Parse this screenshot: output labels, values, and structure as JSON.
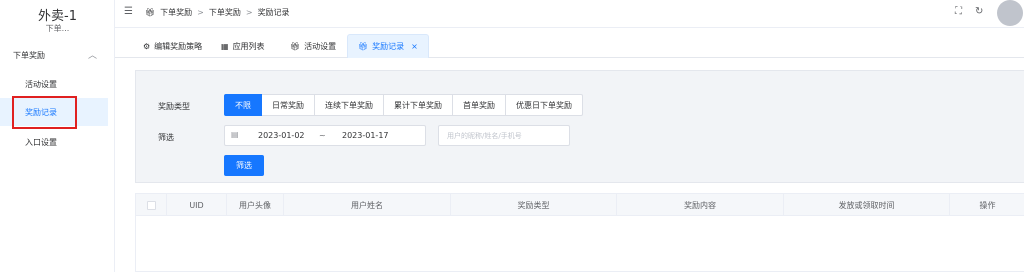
{
  "sidebar": {
    "app_title": "外卖-1",
    "app_subtitle": "下单...",
    "group_label": "下单奖励",
    "items": [
      {
        "label": "活动设置"
      },
      {
        "label": "奖励记录"
      },
      {
        "label": "入口设置"
      }
    ]
  },
  "header": {
    "breadcrumb": [
      "下单奖励",
      "下单奖励",
      "奖励记录"
    ]
  },
  "tabs": [
    {
      "label": "编辑奖励策略",
      "icon": "settings-circle-icon"
    },
    {
      "label": "应用列表",
      "icon": "grid-icon"
    },
    {
      "label": "活动设置",
      "icon": "gift-icon"
    },
    {
      "label": "奖励记录",
      "icon": "gift-icon",
      "active": true
    }
  ],
  "filters": {
    "type_label": "奖励类型",
    "type_options": [
      "不限",
      "日常奖励",
      "连续下单奖励",
      "累计下单奖励",
      "首单奖励",
      "优惠日下单奖励"
    ],
    "screen_label": "筛选",
    "date_start": "2023-01-02",
    "date_end": "2023-01-17",
    "date_sep": "~",
    "search_placeholder": "用户的昵称/姓名/手机号",
    "submit_label": "筛选"
  },
  "table": {
    "columns": [
      "UID",
      "用户头像",
      "用户姓名",
      "奖励类型",
      "奖励内容",
      "发放或领取时间",
      "操作"
    ]
  },
  "colors": {
    "primary": "#1677ff",
    "highlight": "#e02020"
  }
}
